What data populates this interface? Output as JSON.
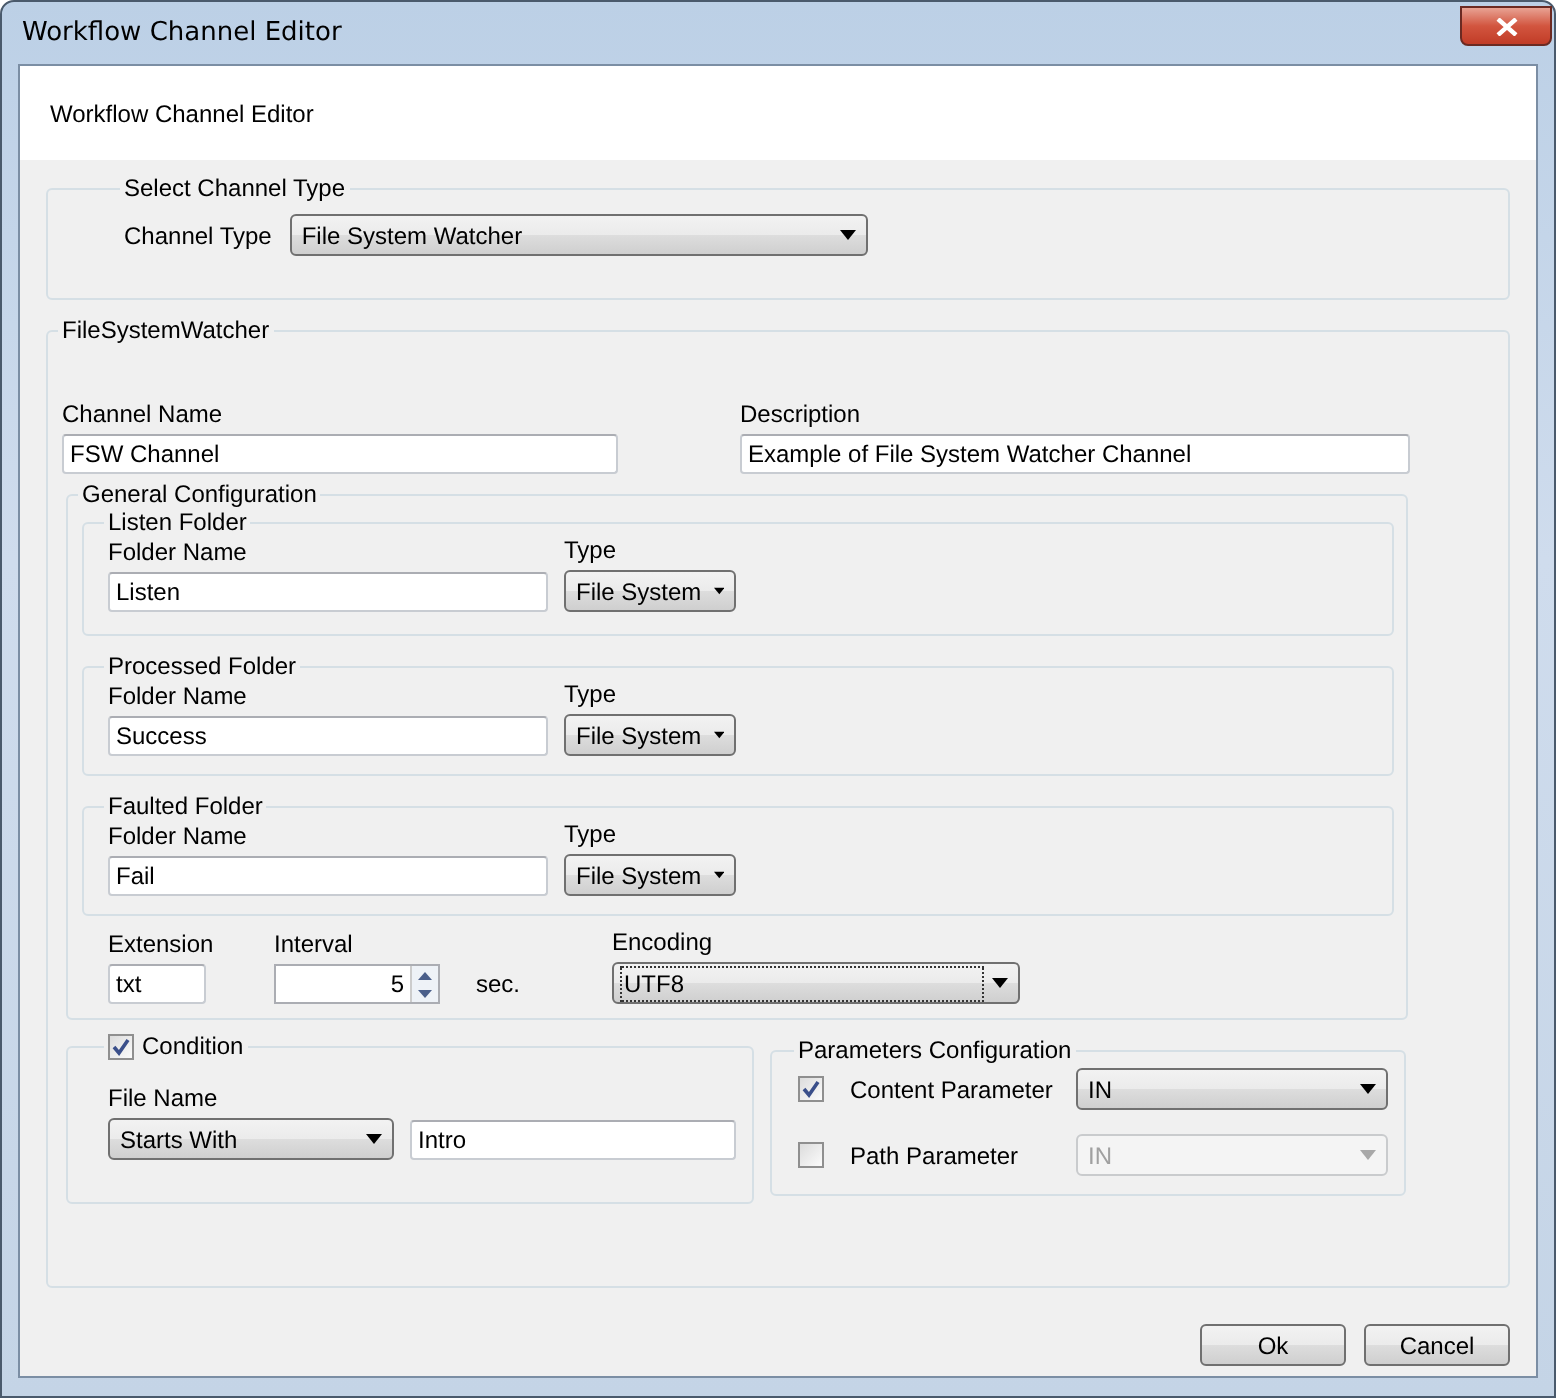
{
  "window": {
    "title": "Workflow Channel Editor"
  },
  "header": {
    "title": "Workflow Channel Editor"
  },
  "channel_type_group": {
    "legend": "Select Channel Type",
    "label": "Channel Type",
    "value": "File System Watcher"
  },
  "watcher_group": {
    "legend": "FileSystemWatcher",
    "channel_name": {
      "label": "Channel Name",
      "value": "FSW Channel"
    },
    "description": {
      "label": "Description",
      "value": "Example of File System Watcher Channel"
    },
    "general": {
      "legend": "General Configuration",
      "folders": [
        {
          "legend": "Listen Folder",
          "name_label": "Folder Name",
          "name_value": "Listen",
          "type_label": "Type",
          "type_value": "File System"
        },
        {
          "legend": "Processed Folder",
          "name_label": "Folder Name",
          "name_value": "Success",
          "type_label": "Type",
          "type_value": "File System"
        },
        {
          "legend": "Faulted Folder",
          "name_label": "Folder Name",
          "name_value": "Fail",
          "type_label": "Type",
          "type_value": "File System"
        }
      ],
      "extension": {
        "label": "Extension",
        "value": "txt"
      },
      "interval": {
        "label": "Interval",
        "value": "5",
        "unit": "sec."
      },
      "encoding": {
        "label": "Encoding",
        "value": "UTF8",
        "focused": true
      }
    },
    "condition": {
      "label": "Condition",
      "checked": true,
      "file_name_label": "File Name",
      "match_value": "Starts With",
      "pattern_value": "Intro"
    },
    "parameters": {
      "legend": "Parameters Configuration",
      "items": [
        {
          "label": "Content Parameter",
          "checked": true,
          "value": "IN",
          "disabled": false
        },
        {
          "label": "Path Parameter",
          "checked": false,
          "value": "IN",
          "disabled": true
        }
      ]
    }
  },
  "buttons": [
    {
      "label": "Ok"
    },
    {
      "label": "Cancel"
    }
  ]
}
